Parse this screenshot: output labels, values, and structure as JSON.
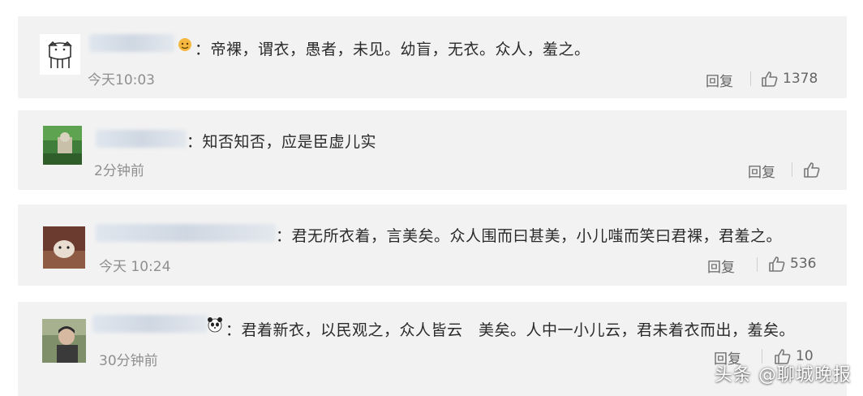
{
  "comments": [
    {
      "name_fragment": "",
      "text": "：帝裸，谓衣，愚者，未见。幼盲，无衣。众人，羞之。",
      "time": "今天10:03",
      "reply_label": "回复",
      "likes": "1378",
      "avatar": "white-dog-avatar"
    },
    {
      "name_fragment": "",
      "text": "：知否知否，应是臣虚儿实",
      "time": "2分钟前",
      "reply_label": "回复",
      "likes": "",
      "avatar": "green-photo-avatar"
    },
    {
      "name_fragment": "",
      "text": "：君无所衣着，言美矣。众人围而曰甚美，小儿嗤而笑曰君裸，君羞之。",
      "time": "今天 10:24",
      "reply_label": "回复",
      "likes": "536",
      "avatar": "dog-photo-avatar"
    },
    {
      "name_fragment": "",
      "text": "：君着新衣，以民观之，众人皆云　美矣。人中一小儿云，君未着衣而出，羞矣。",
      "time": "30分钟前",
      "reply_label": "回复",
      "likes": "10",
      "avatar": "person-photo-avatar"
    }
  ],
  "watermark": "头条 @聊城晚报",
  "colors": {
    "card_bg": "#f2f2f2",
    "text": "#2a2a2a",
    "muted": "#8f8f8f"
  }
}
